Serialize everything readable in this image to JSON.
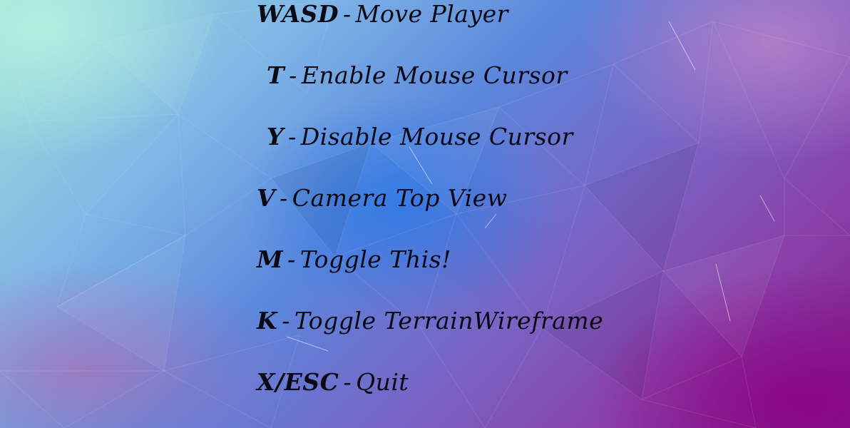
{
  "controls": [
    {
      "key": "WASD",
      "separator": "-",
      "action": "Move Player"
    },
    {
      "key": "T",
      "separator": "-",
      "action": "Enable Mouse Cursor"
    },
    {
      "key": "Y",
      "separator": "-",
      "action": "Disable Mouse Cursor"
    },
    {
      "key": "V",
      "separator": "-",
      "action": "Camera Top View"
    },
    {
      "key": "M",
      "separator": "-",
      "action": "Toggle This!"
    },
    {
      "key": "K",
      "separator": "-",
      "action": "Toggle TerrainWireframe"
    },
    {
      "key": "X/ESC",
      "separator": "-",
      "action": "Quit"
    }
  ],
  "colors": {
    "text": "#0b0a14",
    "accent_blue": "#2878e6",
    "accent_purple": "#8c0082",
    "accent_teal": "#b4f0e1"
  }
}
